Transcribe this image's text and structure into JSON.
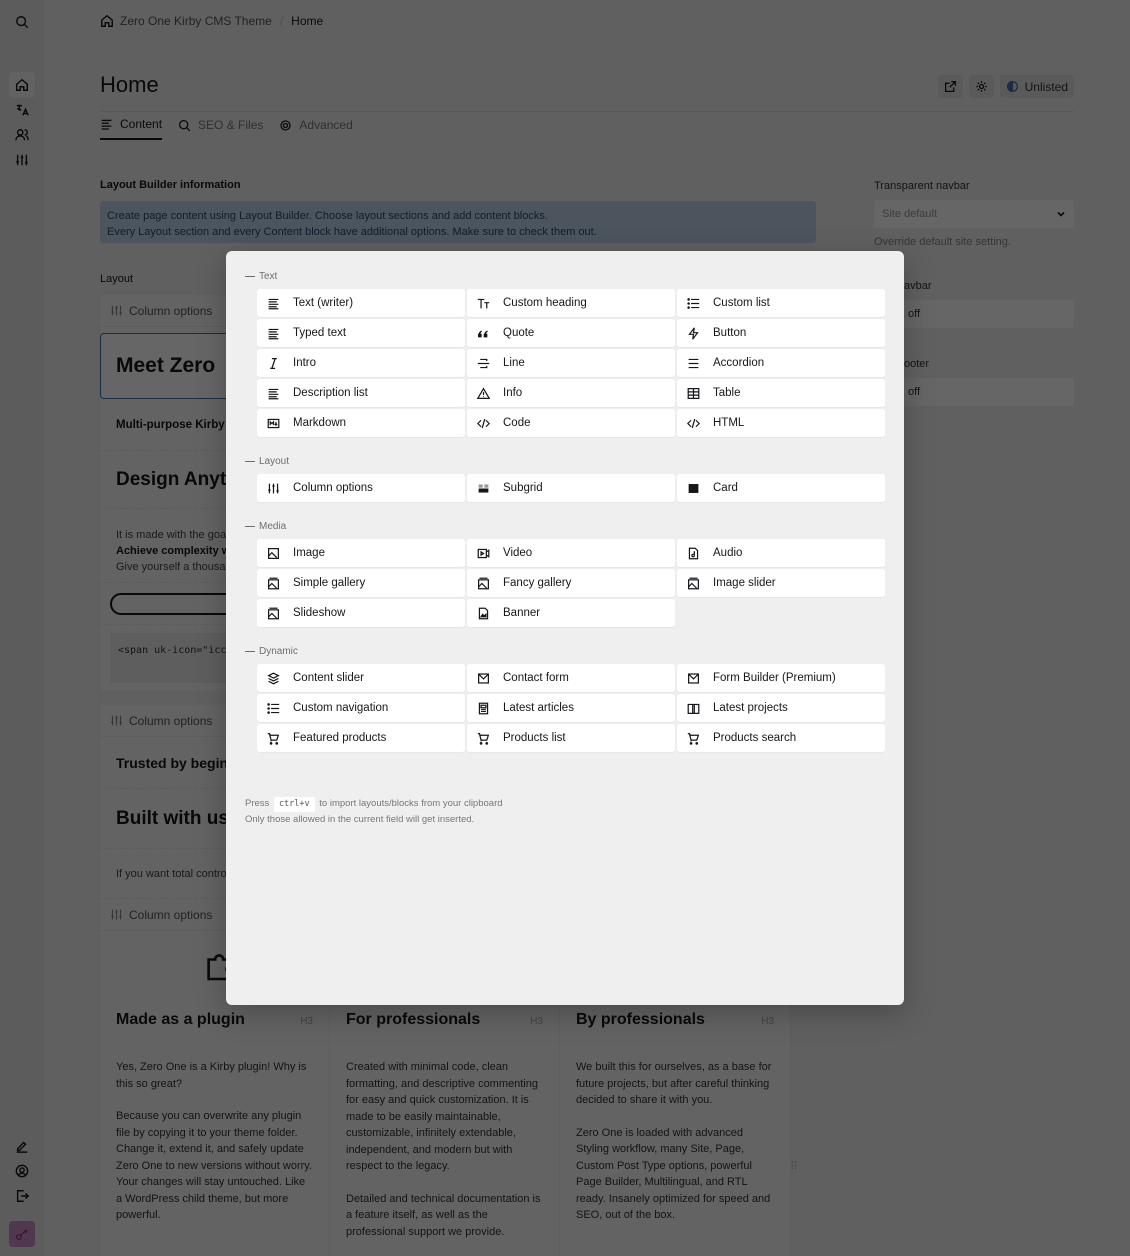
{
  "sidebar": {
    "top": [
      "search-icon"
    ],
    "nav": [
      "home-icon",
      "translate-icon",
      "users-icon",
      "sliders-icon"
    ],
    "bottom": [
      "edit-icon",
      "account-icon",
      "logout-icon",
      "key-icon"
    ],
    "accent": "#a22d8e"
  },
  "breadcrumb": {
    "site": "Zero One Kirby CMS Theme",
    "separator": "/",
    "current": "Home"
  },
  "header": {
    "title": "Home",
    "status": "Unlisted"
  },
  "tabs": [
    {
      "label": "Content",
      "active": true
    },
    {
      "label": "SEO & Files",
      "active": false
    },
    {
      "label": "Advanced",
      "active": false
    }
  ],
  "info": {
    "label": "Layout Builder information",
    "line1": "Create page content using Layout Builder. Choose layout sections and add content blocks.",
    "line2": "Every Layout section and every Content block have additional options. Make sure to check them out."
  },
  "layout": {
    "label": "Layout",
    "column_options": "Column options",
    "blocks": {
      "h1": "Meet Zero",
      "sub": "Multi-purpose Kirby C",
      "h2": "Design Anyth",
      "p1": "It is made with the goa",
      "p2": "Achieve complexity wi",
      "p3": "Give yourself a thousar",
      "code": "<span uk-icon=\"icc",
      "trusted": "Trusted by beginn",
      "built": "Built with usa",
      "control": "If you want total contro"
    },
    "columns": [
      {
        "title": "Made as a plugin",
        "tag": "H3",
        "paragraphs": [
          "Yes, Zero One is a Kirby plugin! Why is this so great?",
          "Because you can overwrite any plugin file by copying it to your theme folder. Change it, extend it, and safely update Zero One to new versions without worry. Your changes will stay untouched. Like a WordPress child theme, but more powerful."
        ]
      },
      {
        "title": "For professionals",
        "tag": "H3",
        "paragraphs": [
          "Created with minimal code, clean formatting, and descriptive commenting for easy and quick customization. It is made to be easily maintainable, customizable, infinitely extendable, independent, and modern but with respect to the legacy.",
          "Detailed and technical documentation is a feature itself, as well as the professional support we provide."
        ]
      },
      {
        "title": "By professionals",
        "tag": "H3",
        "paragraphs": [
          "We built this for ourselves, as a base for future projects, but after careful thinking decided to share it with you.",
          "Zero One is loaded with advanced Styling workflow, many Site, Page, Custom Post Type options, powerful Page Builder, Multilingual, and RTL ready. Insanely optimized for speed and SEO, out of the box."
        ]
      }
    ]
  },
  "right_panel": {
    "transparent_navbar_label": "Transparent navbar",
    "transparent_navbar_value": "Site default",
    "transparent_navbar_help": "Override default site setting.",
    "navbar_label": "avbar",
    "navbar_value": "off",
    "footer_label": "ooter",
    "footer_value": "off"
  },
  "dialog": {
    "groups": [
      {
        "title": "Text",
        "items": [
          {
            "label": "Text (writer)",
            "icon": "text-left"
          },
          {
            "label": "Custom heading",
            "icon": "title"
          },
          {
            "label": "Custom list",
            "icon": "list-bullet"
          },
          {
            "label": "Typed text",
            "icon": "text-left"
          },
          {
            "label": "Quote",
            "icon": "quote"
          },
          {
            "label": "Button",
            "icon": "bolt"
          },
          {
            "label": "Intro",
            "icon": "italic"
          },
          {
            "label": "Line",
            "icon": "line"
          },
          {
            "label": "Accordion",
            "icon": "menu"
          },
          {
            "label": "Description list",
            "icon": "text-left"
          },
          {
            "label": "Info",
            "icon": "alert"
          },
          {
            "label": "Table",
            "icon": "table"
          },
          {
            "label": "Markdown",
            "icon": "markdown"
          },
          {
            "label": "Code",
            "icon": "code"
          },
          {
            "label": "HTML",
            "icon": "code"
          }
        ]
      },
      {
        "title": "Layout",
        "items": [
          {
            "label": "Column options",
            "icon": "sliders"
          },
          {
            "label": "Subgrid",
            "icon": "subgrid"
          },
          {
            "label": "Card",
            "icon": "card"
          }
        ]
      },
      {
        "title": "Media",
        "items": [
          {
            "label": "Image",
            "icon": "image"
          },
          {
            "label": "Video",
            "icon": "video"
          },
          {
            "label": "Audio",
            "icon": "audio"
          },
          {
            "label": "Simple gallery",
            "icon": "gallery"
          },
          {
            "label": "Fancy gallery",
            "icon": "gallery"
          },
          {
            "label": "Image slider",
            "icon": "gallery"
          },
          {
            "label": "Slideshow",
            "icon": "gallery"
          },
          {
            "label": "Banner",
            "icon": "file-image"
          }
        ]
      },
      {
        "title": "Dynamic",
        "items": [
          {
            "label": "Content slider",
            "icon": "layers"
          },
          {
            "label": "Contact form",
            "icon": "mail"
          },
          {
            "label": "Form Builder (Premium)",
            "icon": "mail"
          },
          {
            "label": "Custom navigation",
            "icon": "list-bullet"
          },
          {
            "label": "Latest articles",
            "icon": "article"
          },
          {
            "label": "Latest projects",
            "icon": "book"
          },
          {
            "label": "Featured products",
            "icon": "cart"
          },
          {
            "label": "Products list",
            "icon": "cart"
          },
          {
            "label": "Products search",
            "icon": "cart"
          }
        ]
      }
    ],
    "hint_press": "Press",
    "hint_key": "ctrl+v",
    "hint_rest": "to import layouts/blocks from your clipboard",
    "hint_line2": "Only those allowed in the current field will get inserted."
  }
}
